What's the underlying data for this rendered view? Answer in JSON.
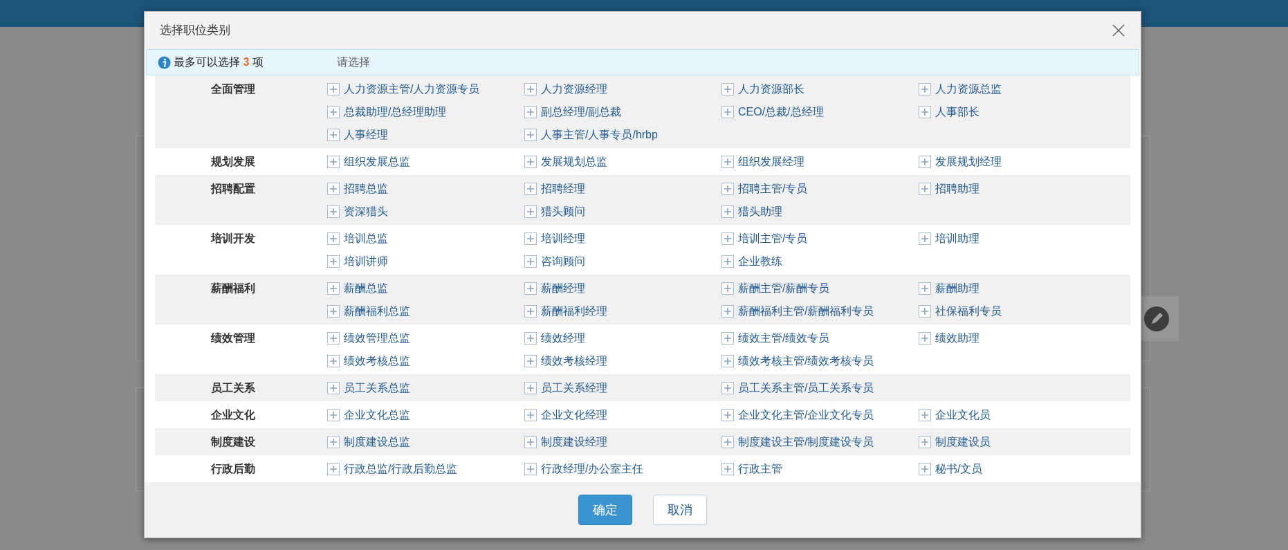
{
  "dialog": {
    "title": "选择职位类别",
    "notice": "最多可以选择 **3** 项",
    "selection_placeholder": "请选择",
    "groups": [
      {
        "label": "全面管理",
        "items": [
          "人力资源主管/人力资源专员",
          "人力资源经理",
          "人力资源部长",
          "人力资源总监",
          "总裁助理/总经理助理",
          "副总经理/副总裁",
          "CEO/总裁/总经理",
          "人事部长",
          "人事经理",
          "人事主管/人事专员/hrbp"
        ]
      },
      {
        "label": "规划发展",
        "items": [
          "组织发展总监",
          "发展规划总监",
          "组织发展经理",
          "发展规划经理"
        ]
      },
      {
        "label": "招聘配置",
        "items": [
          "招聘总监",
          "招聘经理",
          "招聘主管/专员",
          "招聘助理",
          "资深猎头",
          "猎头顾问",
          "猎头助理"
        ]
      },
      {
        "label": "培训开发",
        "items": [
          "培训总监",
          "培训经理",
          "培训主管/专员",
          "培训助理",
          "培训讲师",
          "咨询顾问",
          "企业教练"
        ]
      },
      {
        "label": "薪酬福利",
        "items": [
          "薪酬总监",
          "薪酬经理",
          "薪酬主管/薪酬专员",
          "薪酬助理",
          "薪酬福利总监",
          "薪酬福利经理",
          "薪酬福利主管/薪酬福利专员",
          "社保福利专员"
        ]
      },
      {
        "label": "绩效管理",
        "items": [
          "绩效管理总监",
          "绩效经理",
          "绩效主管/绩效专员",
          "绩效助理",
          "绩效考核总监",
          "绩效考核经理",
          "绩效考核主管/绩效考核专员"
        ]
      },
      {
        "label": "员工关系",
        "items": [
          "员工关系总监",
          "员工关系经理",
          "员工关系主管/员工关系专员"
        ]
      },
      {
        "label": "企业文化",
        "items": [
          "企业文化总监",
          "企业文化经理",
          "企业文化主管/企业文化专员",
          "企业文化员"
        ]
      },
      {
        "label": "制度建设",
        "items": [
          "制度建设总监",
          "制度建设经理",
          "制度建设主管/制度建设专员",
          "制度建设员"
        ]
      },
      {
        "label": "行政后勤",
        "items": [
          "行政总监/行政后勤总监",
          "行政经理/办公室主任",
          "行政主管",
          "秘书/文员"
        ]
      }
    ],
    "buttons": [
      {
        "label": "确定",
        "kind": "primary"
      },
      {
        "label": "取消",
        "kind": "secondary"
      }
    ]
  }
}
